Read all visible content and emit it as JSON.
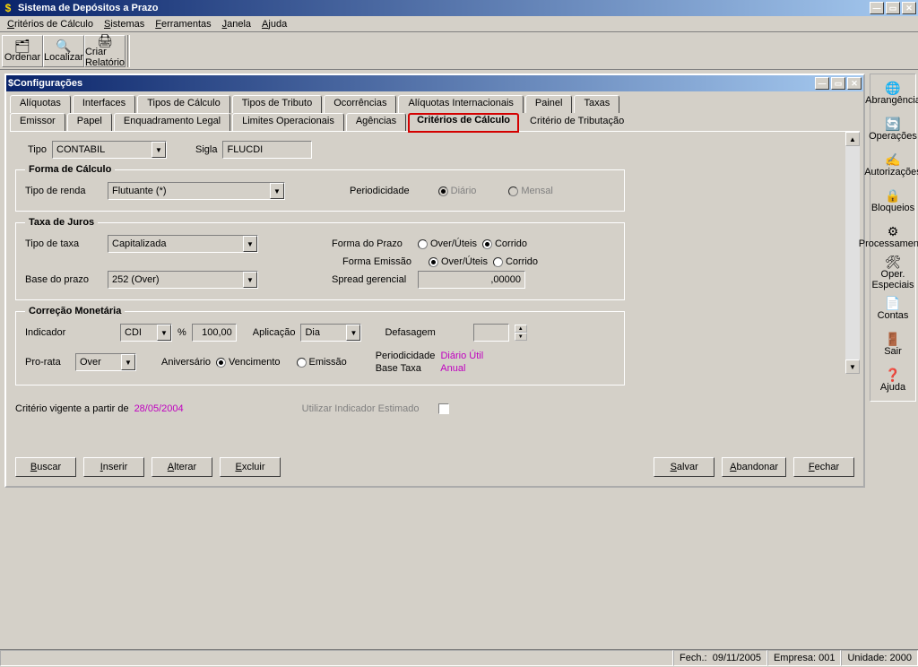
{
  "app": {
    "title": "Sistema de Depósitos a Prazo"
  },
  "menu": {
    "m1": "Critérios de Cálculo",
    "m2": "Sistemas",
    "m3": "Ferramentas",
    "m4": "Janela",
    "m5": "Ajuda"
  },
  "toolbar": {
    "ordenar": "Ordenar",
    "localizar": "Localizar",
    "criar": "Criar Relatório"
  },
  "child": {
    "title": "Configurações"
  },
  "tabs": {
    "row1": {
      "t1": "Alíquotas",
      "t2": "Interfaces",
      "t3": "Tipos de Cálculo",
      "t4": "Tipos de Tributo",
      "t5": "Ocorrências",
      "t6": "Alíquotas Internacionais",
      "t7": "Painel",
      "t8": "Taxas"
    },
    "row2": {
      "t1": "Emissor",
      "t2": "Papel",
      "t3": "Enquadramento Legal",
      "t4": "Limites Operacionais",
      "t5": "Agências",
      "t6": "Critérios de Cálculo",
      "t7": "Critério de Tributação"
    }
  },
  "form": {
    "tipo_lbl": "Tipo",
    "tipo_val": "CONTABIL",
    "sigla_lbl": "Sigla",
    "sigla_val": "FLUCDI"
  },
  "grp_forma": {
    "legend": "Forma de Cálculo",
    "tipo_renda_lbl": "Tipo de renda",
    "tipo_renda_val": "Flutuante (*)",
    "periodicidade_lbl": "Periodicidade",
    "r_diario": "Diário",
    "r_mensal": "Mensal"
  },
  "grp_taxa": {
    "legend": "Taxa de Juros",
    "tipo_taxa_lbl": "Tipo de taxa",
    "tipo_taxa_val": "Capitalizada",
    "forma_prazo_lbl": "Forma do Prazo",
    "r_overuteis": "Over/Úteis",
    "r_corrido": "Corrido",
    "forma_emissao_lbl": "Forma Emissão",
    "base_prazo_lbl": "Base do prazo",
    "base_prazo_val": "252 (Over)",
    "spread_lbl": "Spread gerencial",
    "spread_val": ",00000"
  },
  "grp_corr": {
    "legend": "Correção Monetária",
    "indicador_lbl": "Indicador",
    "indicador_val": "CDI",
    "pct_lbl": "%",
    "pct_val": "100,00",
    "aplicacao_lbl": "Aplicação",
    "aplicacao_val": "Dia",
    "defasagem_lbl": "Defasagem",
    "defasagem_val": "",
    "prorata_lbl": "Pro-rata",
    "prorata_val": "Over",
    "aniversario_lbl": "Aniversário",
    "r_venc": "Vencimento",
    "r_emiss": "Emissão",
    "period_lbl": "Periodicidade",
    "period_val": "Diário Útil",
    "basetaxa_lbl": "Base Taxa",
    "basetaxa_val": "Anual"
  },
  "footer": {
    "criterio_lbl": "Critério vigente a partir de ",
    "criterio_date": "28/05/2004",
    "util_ind_lbl": "Utilizar Indicador Estimado"
  },
  "buttons": {
    "buscar": "Buscar",
    "inserir": "Inserir",
    "alterar": "Alterar",
    "excluir": "Excluir",
    "salvar": "Salvar",
    "abandonar": "Abandonar",
    "fechar": "Fechar"
  },
  "side": {
    "abrang": "Abrangência",
    "oper": "Operações",
    "autoriz": "Autorizações",
    "bloq": "Bloqueios",
    "process": "Processamento",
    "oper_esp": "Oper. Especiais",
    "contas": "Contas",
    "sair": "Sair",
    "ajuda": "Ajuda"
  },
  "status": {
    "fech_lbl": "Fech.:",
    "fech_val": "09/11/2005",
    "emp_lbl": "Empresa: 001",
    "unid_lbl": "Unidade: 2000"
  }
}
